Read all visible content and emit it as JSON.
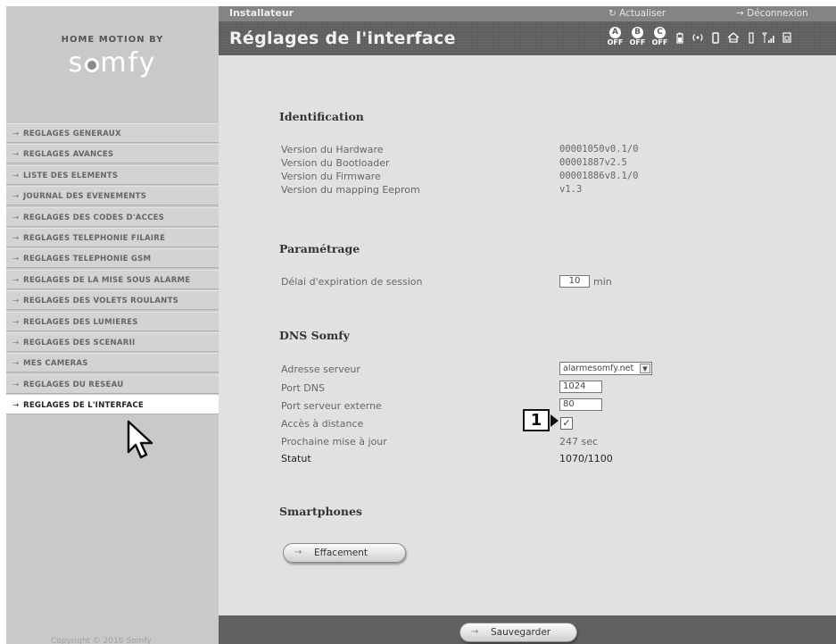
{
  "brand": {
    "top_line": "HOME MOTION BY",
    "logo_pre": "s",
    "logo_post": "mfy",
    "copyright": "Copyright © 2010 Somfy"
  },
  "topbar": {
    "role": "Installateur",
    "refresh_label": "↻ Actualiser",
    "logout_label": "→ Déconnexion"
  },
  "header": {
    "title": "Réglages de l'interface",
    "zones": [
      {
        "letter": "A",
        "state": "OFF"
      },
      {
        "letter": "B",
        "state": "OFF"
      },
      {
        "letter": "C",
        "state": "OFF"
      }
    ]
  },
  "sidebar": {
    "items": [
      {
        "label": "REGLAGES GENERAUX"
      },
      {
        "label": "REGLAGES AVANCES"
      },
      {
        "label": "LISTE DES ELEMENTS"
      },
      {
        "label": "JOURNAL DES EVENEMENTS"
      },
      {
        "label": "REGLAGES DES CODES D'ACCES"
      },
      {
        "label": "REGLAGES TELEPHONIE FILAIRE"
      },
      {
        "label": "REGLAGES TELEPHONIE GSM"
      },
      {
        "label": "REGLAGES DE LA MISE SOUS ALARME"
      },
      {
        "label": "REGLAGES DES VOLETS ROULANTS"
      },
      {
        "label": "REGLAGES DES LUMIERES"
      },
      {
        "label": "REGLAGES DES SCENARII"
      },
      {
        "label": "MES CAMERAS"
      },
      {
        "label": "REGLAGES DU RESEAU"
      },
      {
        "label": "REGLAGES DE L'INTERFACE"
      }
    ],
    "active_index": 13
  },
  "identification": {
    "title": "Identification",
    "rows": [
      {
        "label": "Version du Hardware",
        "value": "00001050v0.1/0"
      },
      {
        "label": "Version du Bootloader",
        "value": "00001887v2.5"
      },
      {
        "label": "Version du Firmware",
        "value": "00001886v8.1/0"
      },
      {
        "label": "Version du mapping Eeprom",
        "value": "v1.3"
      }
    ]
  },
  "parametrage": {
    "title": "Paramétrage",
    "session_label": "Délai d'expiration de session",
    "session_value": "10",
    "session_unit": "min"
  },
  "dns": {
    "title": "DNS Somfy",
    "server_label": "Adresse serveur",
    "server_value": "alarmesomfy.net",
    "port_dns_label": "Port DNS",
    "port_dns_value": "1024",
    "port_ext_label": "Port serveur externe",
    "port_ext_value": "80",
    "remote_label": "Accès à distance",
    "remote_checked": "✓",
    "next_update_label": "Prochaine mise à jour",
    "next_update_value": "247 sec",
    "status_label": "Statut",
    "status_value": "1070/1100",
    "callout": "1"
  },
  "smartphones": {
    "title": "Smartphones",
    "erase_label": "Effacement"
  },
  "footer": {
    "save_label": "Sauvegarder"
  }
}
